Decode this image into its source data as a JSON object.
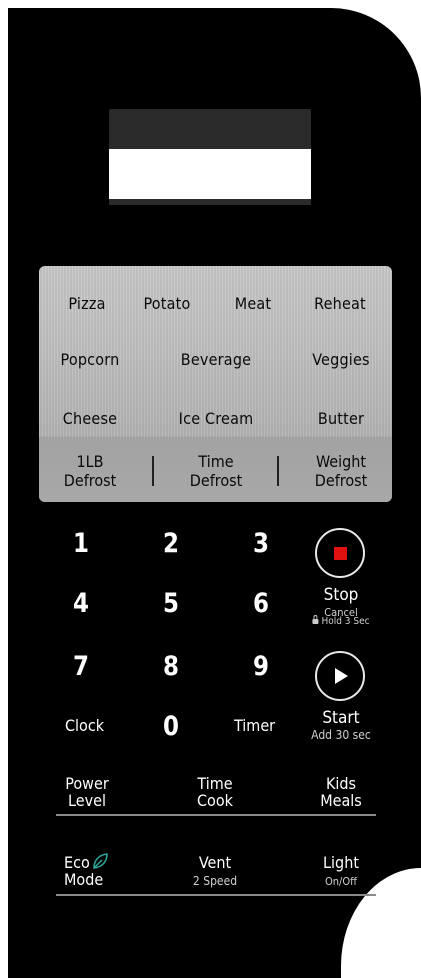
{
  "auto_cook": {
    "row1": [
      "Pizza",
      "Potato",
      "Meat",
      "Reheat"
    ],
    "row2": [
      "Popcorn",
      "Beverage",
      "Veggies"
    ],
    "row3": [
      "Cheese",
      "Ice Cream",
      "Butter"
    ]
  },
  "defrost": {
    "one_lb": {
      "line1": "1LB",
      "line2": "Defrost"
    },
    "time": {
      "line1": "Time",
      "line2": "Defrost"
    },
    "weight": {
      "line1": "Weight",
      "line2": "Defrost"
    }
  },
  "keypad": {
    "digits": [
      "1",
      "2",
      "3",
      "4",
      "5",
      "6",
      "7",
      "8",
      "9",
      "0"
    ],
    "clock": "Clock",
    "timer": "Timer"
  },
  "stop": {
    "label": "Stop",
    "sub": "Cancel",
    "hold": "Hold 3 Sec"
  },
  "start": {
    "label": "Start",
    "sub": "Add 30 sec"
  },
  "function_row1": {
    "power": {
      "line1": "Power",
      "line2": "Level"
    },
    "time_cook": {
      "line1": "Time",
      "line2": "Cook"
    },
    "kids": {
      "line1": "Kids",
      "line2": "Meals"
    }
  },
  "function_row2": {
    "eco": {
      "line1": "Eco",
      "line2": "Mode"
    },
    "vent": {
      "label": "Vent",
      "sub": "2 Speed"
    },
    "light": {
      "label": "Light",
      "sub": "On/Off"
    }
  },
  "colors": {
    "panel": "#000000",
    "stop_accent": "#e01010",
    "eco_leaf": "#2fa8a0"
  }
}
